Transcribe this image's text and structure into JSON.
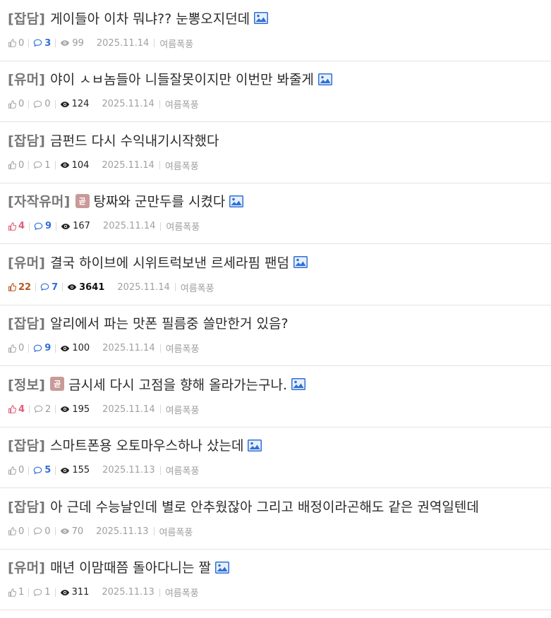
{
  "colors": {
    "category": "#777777",
    "comment_count": "#2f6fd6",
    "like_hot": "#e05c7a",
    "like_very_hot": "#b5561f",
    "badge_bg": "#c99a98",
    "image_icon": "#2f6fd6"
  },
  "posts": [
    {
      "category": "[잡담]",
      "hot": false,
      "title": "게이들아 이차 뭐냐?? 눈뽕오지던데",
      "has_image": true,
      "likes": "0",
      "comments": "3",
      "views": "99",
      "date": "2025.11.14",
      "author": "여름폭풍",
      "like_style": "normal",
      "comment_style": "blue",
      "view_style": "light"
    },
    {
      "category": "[유머]",
      "hot": false,
      "title": "야이 ㅅㅂ놈들아 니들잘못이지만 이번만 봐줄게",
      "has_image": true,
      "likes": "0",
      "comments": "0",
      "views": "124",
      "date": "2025.11.14",
      "author": "여름폭풍",
      "like_style": "normal",
      "comment_style": "normal",
      "view_style": "dark"
    },
    {
      "category": "[잡담]",
      "hot": false,
      "title": "금펀드 다시 수익내기시작했다",
      "has_image": false,
      "likes": "0",
      "comments": "1",
      "views": "104",
      "date": "2025.11.14",
      "author": "여름폭풍",
      "like_style": "normal",
      "comment_style": "normal",
      "view_style": "dark"
    },
    {
      "category": "[자작유머]",
      "hot": true,
      "badge": "곧",
      "title": "탕짜와 군만두를 시켰다",
      "has_image": true,
      "likes": "4",
      "comments": "9",
      "views": "167",
      "date": "2025.11.14",
      "author": "여름폭풍",
      "like_style": "red",
      "comment_style": "blue",
      "view_style": "dark"
    },
    {
      "category": "[유머]",
      "hot": false,
      "title": "결국 하이브에 시위트럭보낸 르세라핌 팬덤",
      "has_image": true,
      "likes": "22",
      "comments": "7",
      "views": "3641",
      "date": "2025.11.14",
      "author": "여름폭풍",
      "like_style": "brown",
      "comment_style": "blue",
      "view_style": "bold"
    },
    {
      "category": "[잡담]",
      "hot": false,
      "title": "알리에서 파는 맛폰 필름중 쓸만한거 있음?",
      "has_image": false,
      "likes": "0",
      "comments": "9",
      "views": "100",
      "date": "2025.11.14",
      "author": "여름폭풍",
      "like_style": "normal",
      "comment_style": "blue",
      "view_style": "dark"
    },
    {
      "category": "[정보]",
      "hot": true,
      "badge": "곧",
      "title": "금시세 다시 고점을 향해 올라가는구나.",
      "has_image": true,
      "likes": "4",
      "comments": "2",
      "views": "195",
      "date": "2025.11.14",
      "author": "여름폭풍",
      "like_style": "red",
      "comment_style": "normal",
      "view_style": "dark"
    },
    {
      "category": "[잡담]",
      "hot": false,
      "title": "스마트폰용 오토마우스하나 샀는데",
      "has_image": true,
      "likes": "0",
      "comments": "5",
      "views": "155",
      "date": "2025.11.13",
      "author": "여름폭풍",
      "like_style": "normal",
      "comment_style": "blue",
      "view_style": "dark"
    },
    {
      "category": "[잡담]",
      "hot": false,
      "title": "아 근데 수능날인데 별로 안추웠잖아 그리고 배정이라곤해도 같은 권역일텐데",
      "has_image": false,
      "likes": "0",
      "comments": "0",
      "views": "70",
      "date": "2025.11.13",
      "author": "여름폭풍",
      "like_style": "normal",
      "comment_style": "normal",
      "view_style": "light"
    },
    {
      "category": "[유머]",
      "hot": false,
      "title": "매년 이맘때쯤 돌아다니는 짤",
      "has_image": true,
      "likes": "1",
      "comments": "1",
      "views": "311",
      "date": "2025.11.13",
      "author": "여름폭풍",
      "like_style": "normal",
      "comment_style": "normal",
      "view_style": "dark"
    }
  ]
}
